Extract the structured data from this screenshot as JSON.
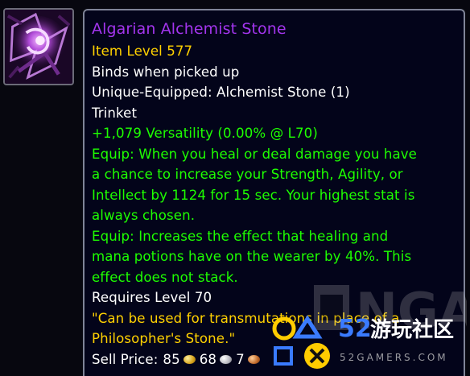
{
  "item": {
    "name": "Algarian Alchemist Stone",
    "item_level": "Item Level 577",
    "binding": "Binds when picked up",
    "unique": "Unique-Equipped: Alchemist Stone (1)",
    "slot": "Trinket",
    "stat": "+1,079 Versatility (0.00% @ L70)",
    "equip1_lines": [
      "Equip: When you heal or deal damage you have",
      "a chance to increase your Strength, Agility, or",
      "Intellect by 1124 for 15 sec. Your highest stat is",
      "always chosen."
    ],
    "equip2_lines": [
      "Equip: Increases the effect that healing and",
      "mana potions have on the wearer by 40%.  This",
      "effect does not stack."
    ],
    "requires": "Requires Level 70",
    "flavor_lines": [
      "\"Can be used for transmutations in place of a",
      "Philosopher's Stone.\""
    ],
    "sell_label": "Sell Price:",
    "sell_gold": "85",
    "sell_silver": "68",
    "sell_copper": "7",
    "icon": "alchemist-stone-icon"
  },
  "watermark": {
    "logo": "NGA",
    "site_number": "52",
    "site_name": "游玩社区",
    "site_url": "52GAMERS.COM"
  },
  "colors": {
    "quality_epic": "#a335ee",
    "item_level": "#ffd100",
    "green_text": "#1eff00",
    "flavor": "#ffd100",
    "white_text": "#ffffff",
    "tooltip_bg": "#03041a",
    "tooltip_border": "#7f8497"
  }
}
